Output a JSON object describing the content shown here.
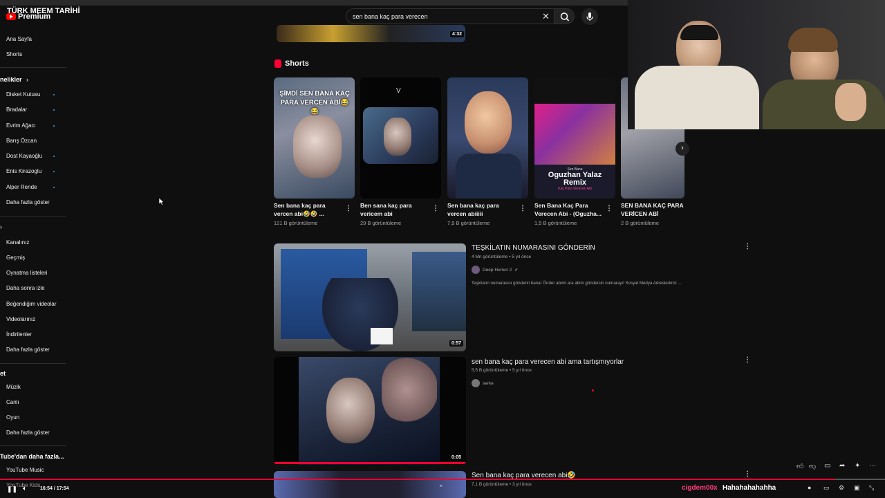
{
  "stream_title": "TÜRK MEEM TARİHİ",
  "logo": {
    "label": "Premium"
  },
  "search": {
    "query": "sen bana kaç para verecen"
  },
  "sidebar": {
    "home": "Ana Sayfa",
    "shorts": "Shorts",
    "subscriptions_header": "nelikler",
    "subscriptions": [
      "Disket Kutusu",
      "Bradalar",
      "Evrim Ağacı",
      "Barış Özcan",
      "Dost Kayaoğlu",
      "Enis Kirazoglu",
      "Alper Rende"
    ],
    "show_more_1": "Daha fazla göster",
    "you_items": [
      "Kanalınız",
      "Geçmiş",
      "Oynatma listeleri",
      "Daha sonra izle",
      "Beğendiğim videolar",
      "Videolarınız",
      "İndirilenler"
    ],
    "show_more_2": "Daha fazla göster",
    "explore_header": "et",
    "explore_items": [
      "Müzik",
      "Canlı",
      "Oyun"
    ],
    "show_more_3": "Daha fazla göster",
    "more_header": "Tube'dan daha fazla...",
    "more_items": [
      "YouTube Music",
      "YouTube Kids"
    ]
  },
  "top_video": {
    "duration": "4:32"
  },
  "shorts_section": {
    "title": "Shorts",
    "items": [
      {
        "title": "Sen bana kaç para vercen abi🤣🤣 ...",
        "views": "121 B görüntüleme",
        "overlay": "ŞİMDİ SEN BANA KAÇ PARA VERCEN ABİ😂😂"
      },
      {
        "title": "Ben sana kaç para vericem abi",
        "views": "29 B görüntüleme"
      },
      {
        "title": "Sen bana kaç para vercen abiiiii",
        "views": "7,9 B görüntüleme"
      },
      {
        "title": "Sen Bana Kaç Para Verecen Abi - (Oguzha...",
        "views": "1,5 B görüntüleme",
        "overlay_top": "Sen Bana",
        "overlay_main": "Oguzhan Yalaz Remix",
        "overlay_sub": "Kaç Para Verecen Abi"
      },
      {
        "title": "SEN BANA KAÇ PARA VERİCEN ABİ",
        "views": "2 B görüntüleme"
      }
    ]
  },
  "videos": [
    {
      "title": "TEŞKİLATIN NUMARASINI GÖNDERİN",
      "meta": "4 Mn görüntüleme • 5 yıl önce",
      "channel": "Deep Humor 2",
      "desc": "Teşkilatın numarasını gönderin bana! Önder abimi ara abim göndersin numarayı! Sosyal Medya Adreslerimiz ...",
      "duration": "0:57"
    },
    {
      "title": "sen bana kaç para verecen abi ama tartışmıyorlar",
      "meta": "5,5 B görüntüleme • 5 yıl önce",
      "channel": "serke",
      "duration": "0:05"
    },
    {
      "title": "Sen bana kaç para verecen abi🤣",
      "meta": "7,1 B görüntüleme • 3 yıl önce"
    }
  ],
  "player": {
    "time": "16:54 / 17:54",
    "progress": 0.943,
    "chat_user": "cigdem00x",
    "chat_message": "Hahahahahahha"
  },
  "colors": {
    "accent": "#ff0033",
    "background": "#0f0f0f",
    "chat_user": "#ff3a7a"
  }
}
